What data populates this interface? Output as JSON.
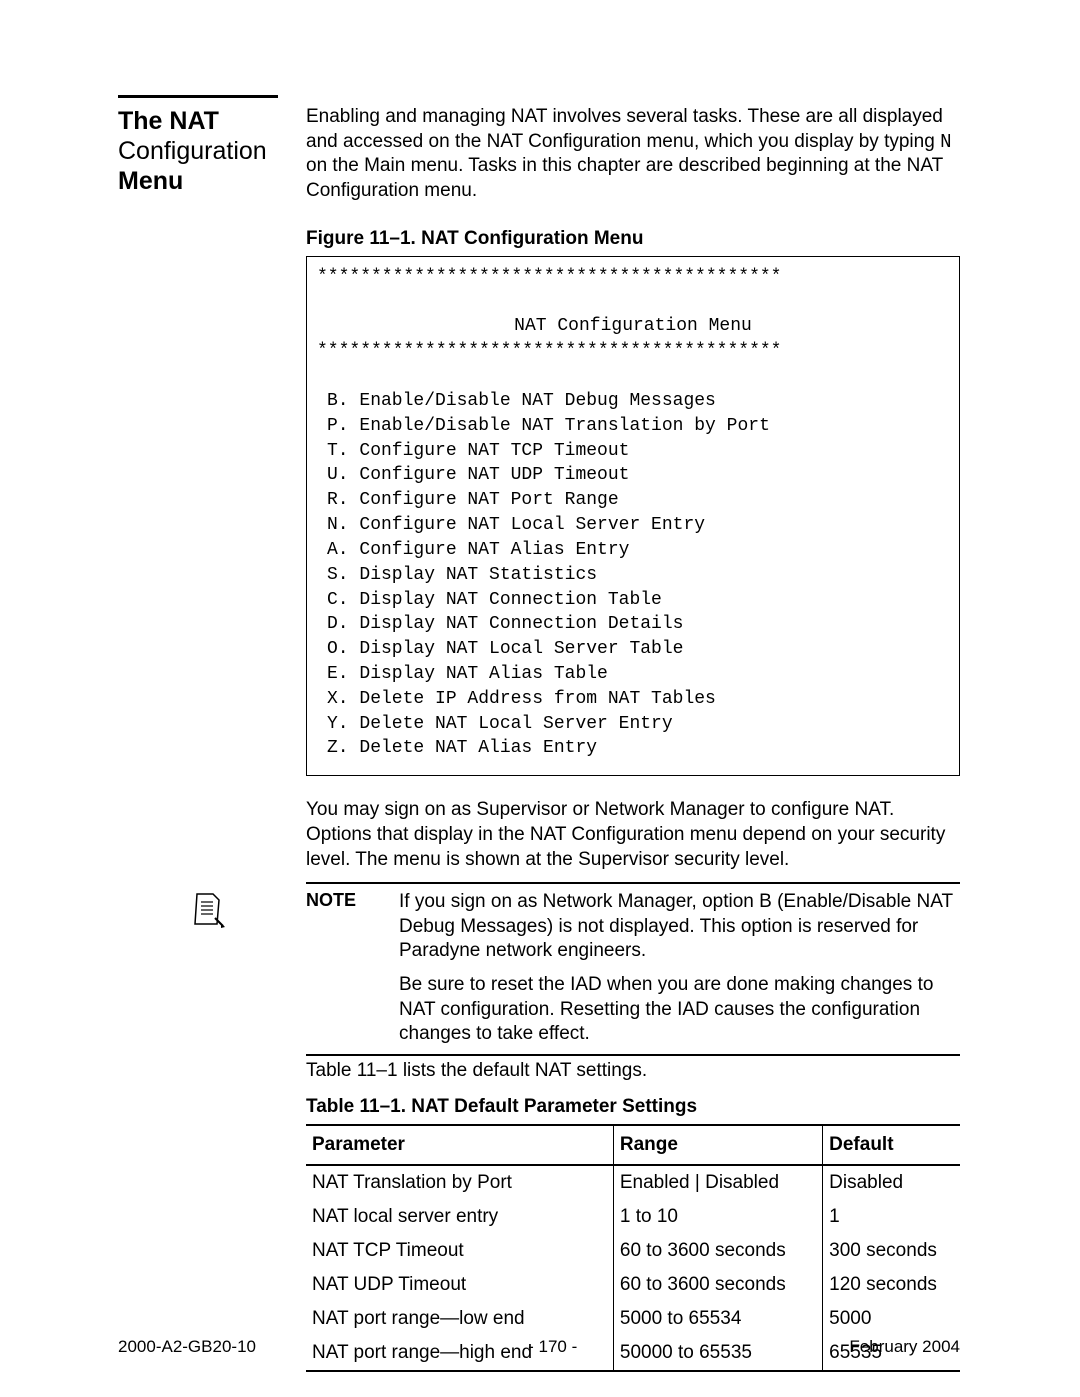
{
  "sidebar": {
    "title_line1": "The NAT",
    "title_line2": "Configuration",
    "title_line3": "Menu"
  },
  "intro": {
    "text_before_N": "Enabling and managing NAT involves several tasks. These are all displayed and accessed on the NAT Configuration menu, which you display by typing ",
    "key": "N",
    "text_after_N": " on the Main menu. Tasks in this chapter are described beginning at the NAT Configuration menu."
  },
  "figure": {
    "caption": "Figure 11–1.  NAT Configuration Menu",
    "stars": "*******************************************",
    "title": "NAT Configuration Menu",
    "items": [
      "B. Enable/Disable NAT Debug Messages",
      "P. Enable/Disable NAT Translation by Port",
      "T. Configure NAT TCP Timeout",
      "U. Configure NAT UDP Timeout",
      "R. Configure NAT Port Range",
      "N. Configure NAT Local Server Entry",
      "A. Configure NAT Alias Entry",
      "S. Display NAT Statistics",
      "C. Display NAT Connection Table",
      "D. Display NAT Connection Details",
      "O. Display NAT Local Server Table",
      "E. Display NAT Alias Table",
      "X. Delete IP Address from NAT Tables",
      "Y. Delete NAT Local Server Entry",
      "Z. Delete NAT Alias Entry"
    ]
  },
  "post_menu": "You may sign on as Supervisor or Network Manager to configure NAT. Options that display in the NAT Configuration menu depend on your security level. The menu is shown at the Supervisor security level.",
  "note": {
    "label": "NOTE",
    "para1": "If you sign on as Network Manager, option B (Enable/Disable NAT Debug Messages) is not displayed. This option is reserved for Paradyne network engineers.",
    "para2": "Be sure to reset the IAD when you are done making changes to NAT configuration. Resetting the IAD causes the configuration changes to take effect."
  },
  "table_intro": "Table 11–1 lists the default NAT settings.",
  "table": {
    "caption": "Table 11–1. NAT Default Parameter Settings",
    "headers": {
      "parameter": "Parameter",
      "range": "Range",
      "default": "Default"
    },
    "rows": [
      {
        "parameter": "NAT Translation by Port",
        "range": "Enabled | Disabled",
        "default": "Disabled"
      },
      {
        "parameter": "NAT local server entry",
        "range": "1 to 10",
        "default": "1"
      },
      {
        "parameter": "NAT TCP Timeout",
        "range": "60 to 3600 seconds",
        "default": "300 seconds"
      },
      {
        "parameter": "NAT UDP Timeout",
        "range": "60 to 3600 seconds",
        "default": "120 seconds"
      },
      {
        "parameter": "NAT port range—low end",
        "range": "5000 to 65534",
        "default": "5000"
      },
      {
        "parameter": "NAT port range—high end",
        "range": "50000 to 65535",
        "default": "65535"
      }
    ]
  },
  "footer": {
    "doc_id": "2000-A2-GB20-10",
    "page_number": "- 170 -",
    "date": "February 2004"
  }
}
